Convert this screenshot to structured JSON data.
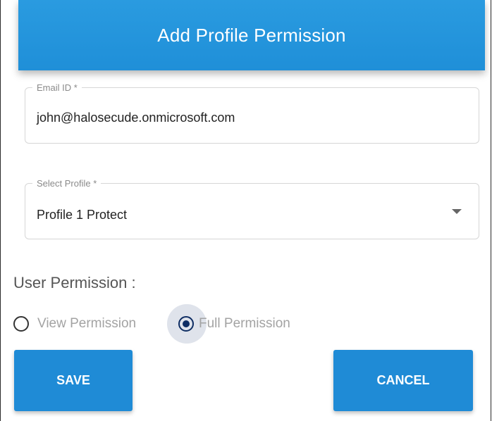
{
  "dialog": {
    "title": "Add Profile Permission"
  },
  "email_field": {
    "label": "Email ID *",
    "value": "john@halosecude.onmicrosoft.com"
  },
  "profile_field": {
    "label": "Select Profile *",
    "value": "Profile 1  Protect"
  },
  "permission": {
    "label": "User Permission :",
    "options": [
      {
        "label": "View Permission",
        "selected": false
      },
      {
        "label": "Full Permission",
        "selected": true
      }
    ]
  },
  "actions": {
    "save_label": "SAVE",
    "cancel_label": "CANCEL"
  },
  "colors": {
    "header": "#1f8fd8",
    "button": "#1f8bd6",
    "radio_selected": "#0e2d63"
  }
}
